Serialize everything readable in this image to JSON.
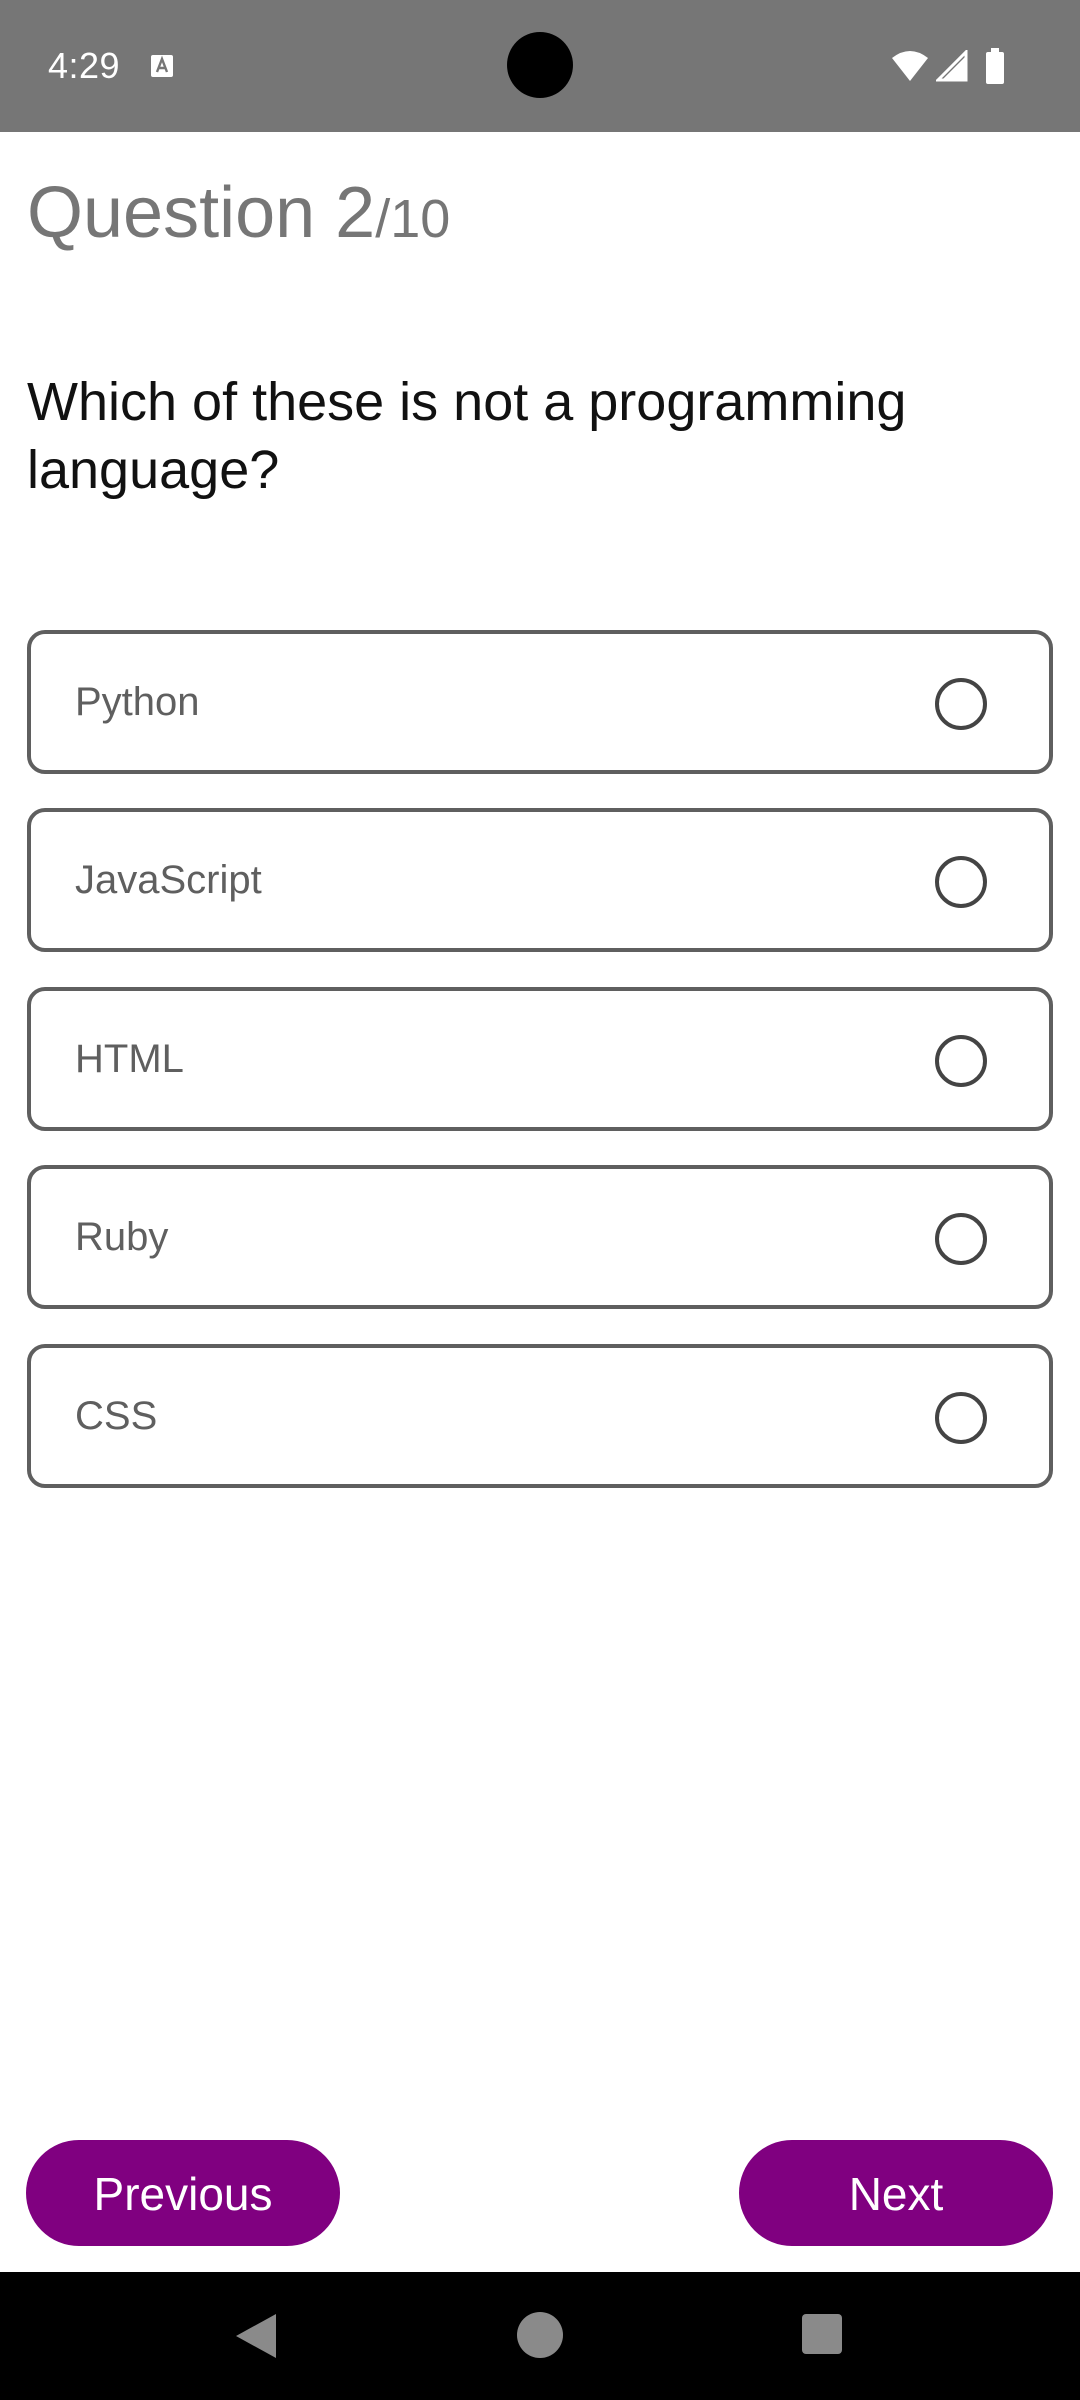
{
  "status_bar": {
    "time": "4:29",
    "background": "#767676",
    "icons": [
      "text-notification-icon",
      "wifi-icon",
      "cell-signal-icon",
      "battery-icon"
    ]
  },
  "quiz": {
    "question_label": "Question 2",
    "question_total": "/10",
    "question_text": "Which of these is not a programming language?",
    "options": [
      {
        "label": "Python",
        "selected": false
      },
      {
        "label": "JavaScript",
        "selected": false
      },
      {
        "label": "HTML",
        "selected": false
      },
      {
        "label": "Ruby",
        "selected": false
      },
      {
        "label": "CSS",
        "selected": false
      }
    ]
  },
  "buttons": {
    "previous_label": "Previous",
    "next_label": "Next",
    "color": "#800080"
  },
  "nav_bar": {
    "icons": [
      "back-icon",
      "home-icon",
      "recents-icon"
    ]
  }
}
